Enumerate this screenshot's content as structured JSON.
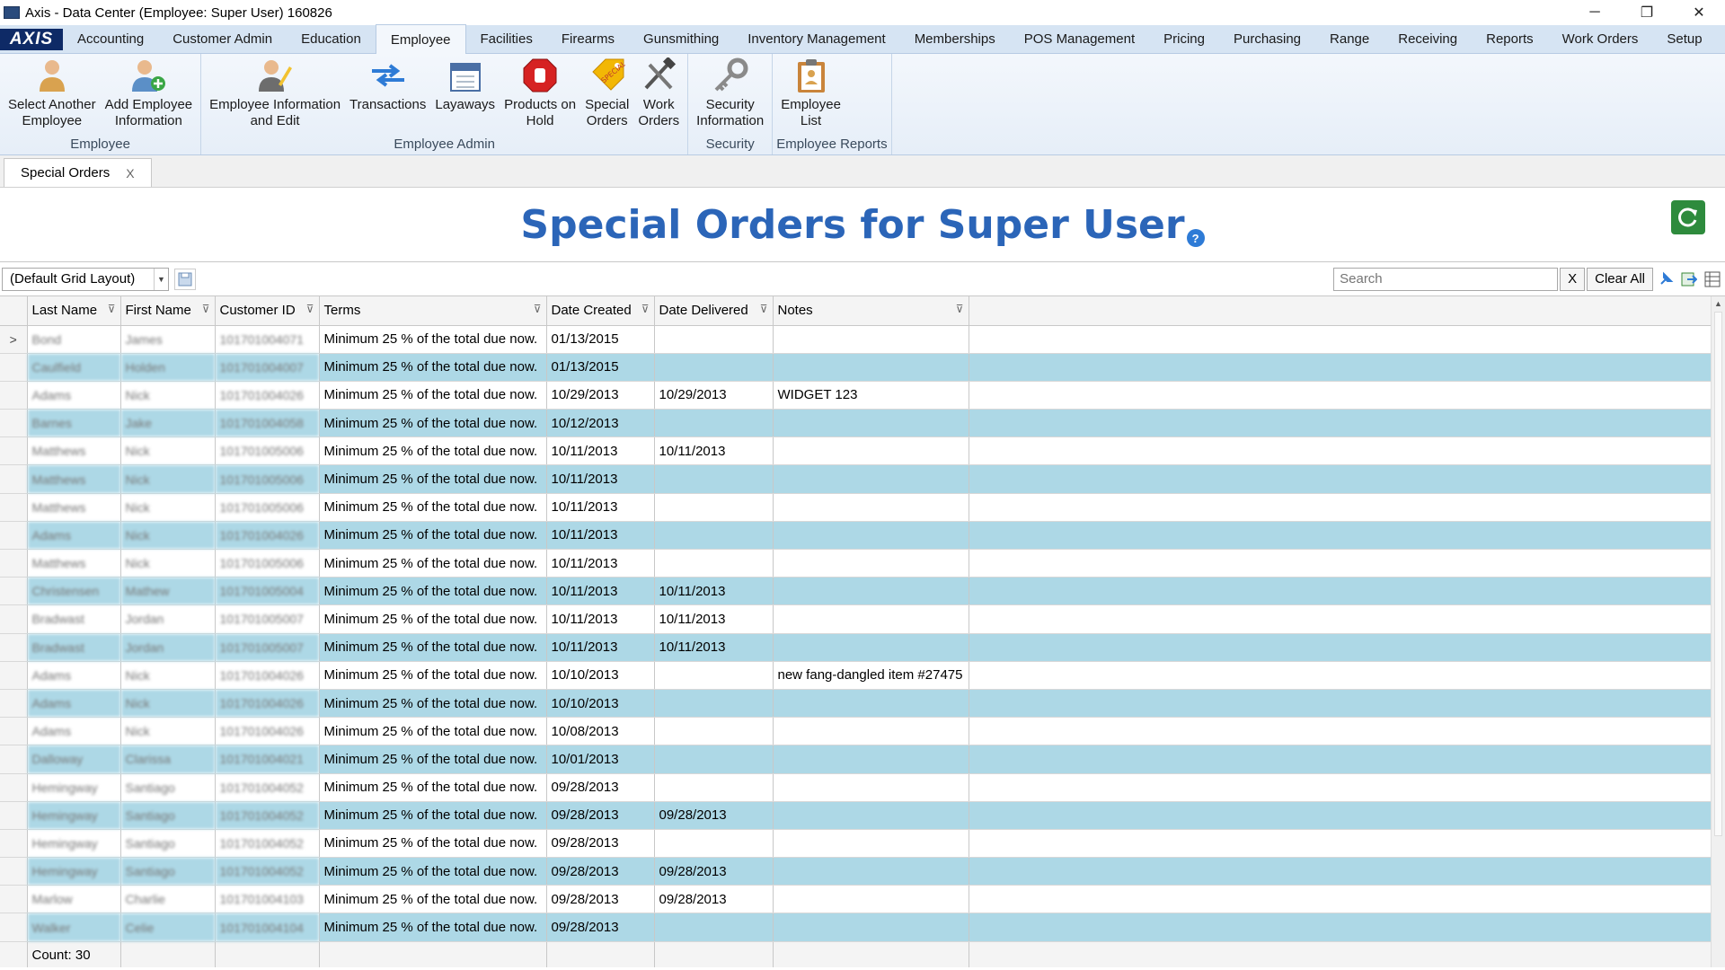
{
  "window": {
    "title": "Axis - Data Center  (Employee: Super User) 160826",
    "minimize": "─",
    "restore": "❐",
    "close": "✕"
  },
  "menu": {
    "logo": "AXIS",
    "items": [
      "Accounting",
      "Customer Admin",
      "Education",
      "Employee",
      "Facilities",
      "Firearms",
      "Gunsmithing",
      "Inventory Management",
      "Memberships",
      "POS Management",
      "Pricing",
      "Purchasing",
      "Range",
      "Receiving",
      "Reports",
      "Work Orders",
      "Setup"
    ],
    "active": "Employee"
  },
  "ribbon": {
    "groups": [
      {
        "label": "Employee",
        "buttons": [
          {
            "line1": "Select Another",
            "line2": "Employee",
            "icon": "person-icon"
          },
          {
            "line1": "Add Employee",
            "line2": "Information",
            "icon": "add-person-icon"
          }
        ]
      },
      {
        "label": "Employee Admin",
        "buttons": [
          {
            "line1": "Employee Information",
            "line2": "and Edit",
            "icon": "person-edit-icon"
          },
          {
            "line1": "Transactions",
            "line2": "",
            "icon": "transfer-arrows-icon"
          },
          {
            "line1": "Layaways",
            "line2": "",
            "icon": "calendar-icon"
          },
          {
            "line1": "Products on",
            "line2": "Hold",
            "icon": "stop-sign-icon"
          },
          {
            "line1": "Special",
            "line2": "Orders",
            "icon": "special-tag-icon"
          },
          {
            "line1": "Work",
            "line2": "Orders",
            "icon": "tools-icon"
          }
        ]
      },
      {
        "label": "Security",
        "buttons": [
          {
            "line1": "Security",
            "line2": "Information",
            "icon": "key-icon"
          }
        ]
      },
      {
        "label": "Employee Reports",
        "buttons": [
          {
            "line1": "Employee",
            "line2": "List",
            "icon": "clipboard-icon"
          }
        ]
      }
    ]
  },
  "doc_tab": {
    "label": "Special Orders",
    "close": "X"
  },
  "page": {
    "title": "Special Orders for Super User",
    "help": "?"
  },
  "grid_toolbar": {
    "layout": "(Default Grid Layout)",
    "search_placeholder": "Search",
    "clear_x": "X",
    "clear_all": "Clear All"
  },
  "columns": [
    "Last Name",
    "First Name",
    "Customer ID",
    "Terms",
    "Date Created",
    "Date Delivered",
    "Notes"
  ],
  "rows": [
    {
      "last": "Bond",
      "first": "James",
      "cid": "101701004071",
      "terms": "Minimum 25 % of the total due now.",
      "created": "01/13/2015",
      "delivered": "",
      "notes": ""
    },
    {
      "last": "Caulfield",
      "first": "Holden",
      "cid": "101701004007",
      "terms": "Minimum 25 % of the total due now.",
      "created": "01/13/2015",
      "delivered": "",
      "notes": ""
    },
    {
      "last": "Adams",
      "first": "Nick",
      "cid": "101701004026",
      "terms": "Minimum 25 % of the total due now.",
      "created": "10/29/2013",
      "delivered": "10/29/2013",
      "notes": "WIDGET 123"
    },
    {
      "last": "Barnes",
      "first": "Jake",
      "cid": "101701004058",
      "terms": "Minimum 25 % of the total due now.",
      "created": "10/12/2013",
      "delivered": "",
      "notes": ""
    },
    {
      "last": "Matthews",
      "first": "Nick",
      "cid": "101701005006",
      "terms": "Minimum 25 % of the total due now.",
      "created": "10/11/2013",
      "delivered": "10/11/2013",
      "notes": ""
    },
    {
      "last": "Matthews",
      "first": "Nick",
      "cid": "101701005006",
      "terms": "Minimum 25 % of the total due now.",
      "created": "10/11/2013",
      "delivered": "",
      "notes": ""
    },
    {
      "last": "Matthews",
      "first": "Nick",
      "cid": "101701005006",
      "terms": "Minimum 25 % of the total due now.",
      "created": "10/11/2013",
      "delivered": "",
      "notes": ""
    },
    {
      "last": "Adams",
      "first": "Nick",
      "cid": "101701004026",
      "terms": "Minimum 25 % of the total due now.",
      "created": "10/11/2013",
      "delivered": "",
      "notes": ""
    },
    {
      "last": "Matthews",
      "first": "Nick",
      "cid": "101701005006",
      "terms": "Minimum 25 % of the total due now.",
      "created": "10/11/2013",
      "delivered": "",
      "notes": ""
    },
    {
      "last": "Christensen",
      "first": "Mathew",
      "cid": "101701005004",
      "terms": "Minimum 25 % of the total due now.",
      "created": "10/11/2013",
      "delivered": "10/11/2013",
      "notes": ""
    },
    {
      "last": "Bradwast",
      "first": "Jordan",
      "cid": "101701005007",
      "terms": "Minimum 25 % of the total due now.",
      "created": "10/11/2013",
      "delivered": "10/11/2013",
      "notes": ""
    },
    {
      "last": "Bradwast",
      "first": "Jordan",
      "cid": "101701005007",
      "terms": "Minimum 25 % of the total due now.",
      "created": "10/11/2013",
      "delivered": "10/11/2013",
      "notes": ""
    },
    {
      "last": "Adams",
      "first": "Nick",
      "cid": "101701004026",
      "terms": "Minimum 25 % of the total due now.",
      "created": "10/10/2013",
      "delivered": "",
      "notes": "new fang-dangled item #27475"
    },
    {
      "last": "Adams",
      "first": "Nick",
      "cid": "101701004026",
      "terms": "Minimum 25 % of the total due now.",
      "created": "10/10/2013",
      "delivered": "",
      "notes": ""
    },
    {
      "last": "Adams",
      "first": "Nick",
      "cid": "101701004026",
      "terms": "Minimum 25 % of the total due now.",
      "created": "10/08/2013",
      "delivered": "",
      "notes": ""
    },
    {
      "last": "Dalloway",
      "first": "Clarissa",
      "cid": "101701004021",
      "terms": "Minimum 25 % of the total due now.",
      "created": "10/01/2013",
      "delivered": "",
      "notes": ""
    },
    {
      "last": "Hemingway",
      "first": "Santiago",
      "cid": "101701004052",
      "terms": "Minimum 25 % of the total due now.",
      "created": "09/28/2013",
      "delivered": "",
      "notes": ""
    },
    {
      "last": "Hemingway",
      "first": "Santiago",
      "cid": "101701004052",
      "terms": "Minimum 25 % of the total due now.",
      "created": "09/28/2013",
      "delivered": "09/28/2013",
      "notes": ""
    },
    {
      "last": "Hemingway",
      "first": "Santiago",
      "cid": "101701004052",
      "terms": "Minimum 25 % of the total due now.",
      "created": "09/28/2013",
      "delivered": "",
      "notes": ""
    },
    {
      "last": "Hemingway",
      "first": "Santiago",
      "cid": "101701004052",
      "terms": "Minimum 25 % of the total due now.",
      "created": "09/28/2013",
      "delivered": "09/28/2013",
      "notes": ""
    },
    {
      "last": "Marlow",
      "first": "Charlie",
      "cid": "101701004103",
      "terms": "Minimum 25 % of the total due now.",
      "created": "09/28/2013",
      "delivered": "09/28/2013",
      "notes": ""
    },
    {
      "last": "Walker",
      "first": "Celie",
      "cid": "101701004104",
      "terms": "Minimum 25 % of the total due now.",
      "created": "09/28/2013",
      "delivered": "",
      "notes": ""
    }
  ],
  "current_row_indicator": ">",
  "footer": {
    "count": "Count: 30"
  },
  "colors": {
    "accent": "#2b65b8",
    "alt_row": "#add8e6",
    "refresh": "#2e8b3d"
  }
}
